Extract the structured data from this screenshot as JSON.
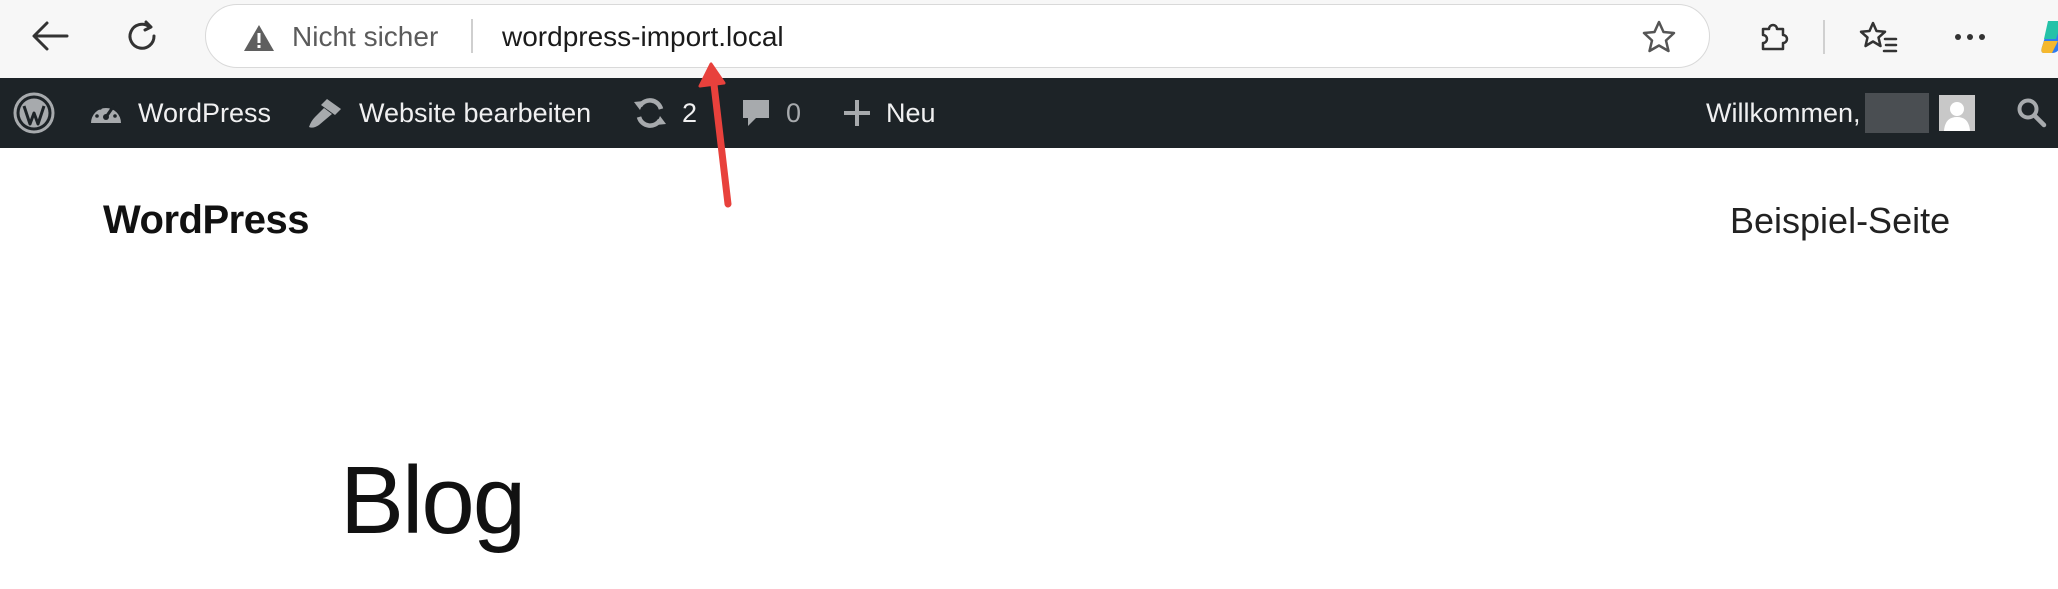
{
  "browser": {
    "security_label": "Nicht sicher",
    "url": "wordpress-import.local"
  },
  "admin_bar": {
    "site_name": "WordPress",
    "edit_site": "Website bearbeiten",
    "updates_count": "2",
    "comments_count": "0",
    "new_label": "Neu",
    "welcome": "Willkommen,"
  },
  "site": {
    "title": "WordPress",
    "nav_link": "Beispiel-Seite",
    "page_heading": "Blog"
  },
  "annotation": {
    "arrow_color": "#e8413c"
  }
}
